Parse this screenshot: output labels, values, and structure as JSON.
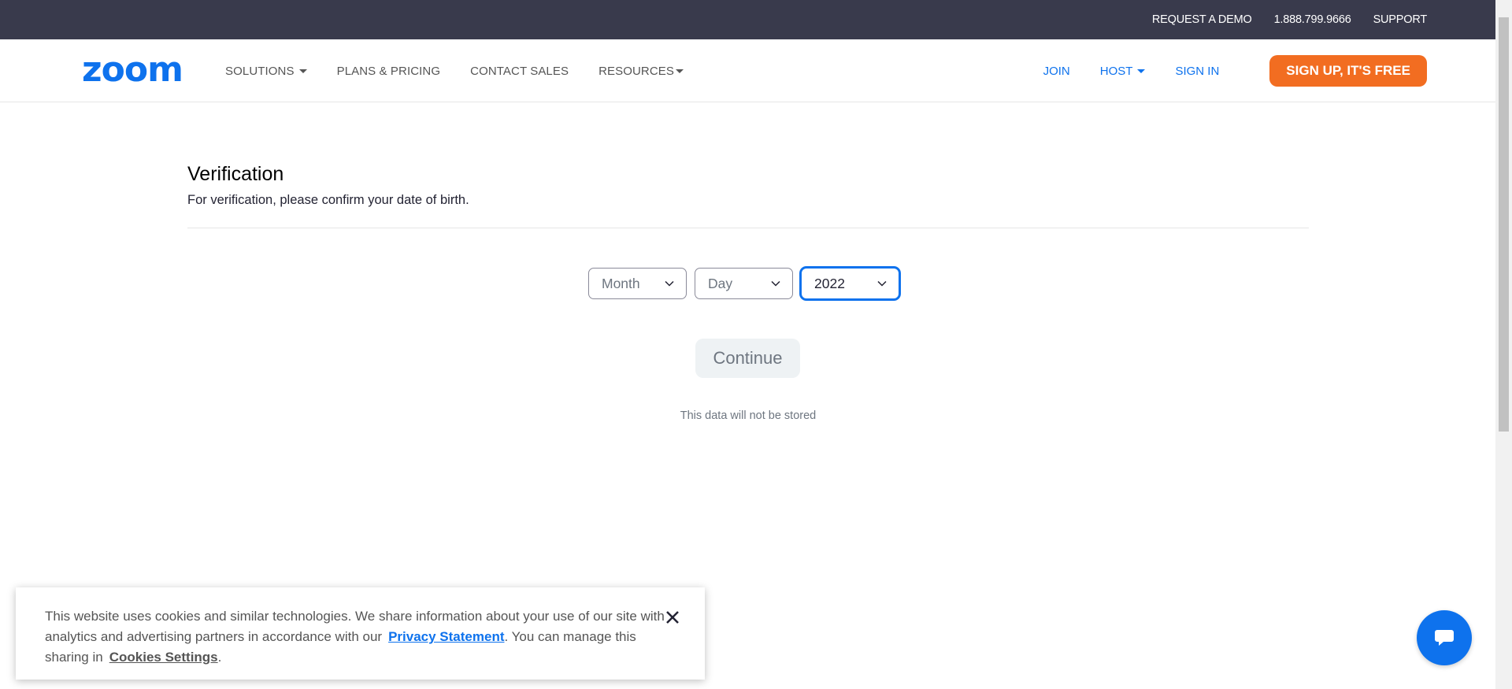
{
  "topbar": {
    "request_demo": "REQUEST A DEMO",
    "phone": "1.888.799.9666",
    "support": "SUPPORT"
  },
  "nav": {
    "logo_text": "zoom",
    "left": [
      {
        "label": "SOLUTIONS",
        "has_dropdown": true
      },
      {
        "label": "PLANS & PRICING",
        "has_dropdown": false
      },
      {
        "label": "CONTACT SALES",
        "has_dropdown": false
      },
      {
        "label": "RESOURCES",
        "has_dropdown": true
      }
    ],
    "join": "JOIN",
    "host": "HOST",
    "sign_in": "SIGN IN",
    "signup": "SIGN UP, IT'S FREE"
  },
  "verification": {
    "title": "Verification",
    "subtitle": "For verification, please confirm your date of birth.",
    "month": "Month",
    "day": "Day",
    "year": "2022",
    "continue": "Continue",
    "note": "This data will not be stored"
  },
  "cookie": {
    "text_1": "This website uses cookies and similar technologies. We share information about your use of our site with analytics and advertising partners in accordance with our",
    "privacy_link": "Privacy Statement",
    "text_2": ". You can manage this sharing in",
    "settings_link": "Cookies Settings",
    "text_3": "."
  },
  "colors": {
    "brand_blue": "#0e72ed",
    "signup_orange": "#f26d21",
    "topbar_bg": "#393a4c"
  },
  "icons": [
    "chevron-down-icon",
    "close-icon",
    "chat-icon",
    "caret-down-icon"
  ]
}
